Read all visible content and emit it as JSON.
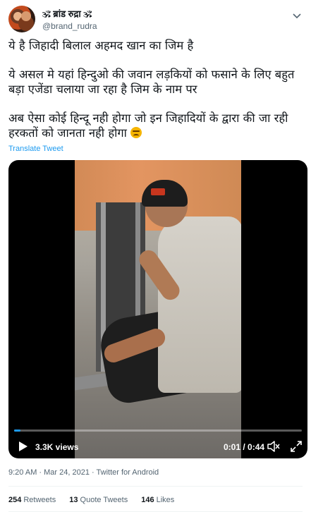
{
  "tweet": {
    "author": {
      "display_name": "🕉 ब्रांड रुद्रा 🕉",
      "handle": "@brand_rudra"
    },
    "text": {
      "line1": "ये है जिहादी बिलाल अहमद खान का जिम है",
      "para2": " ये असल मे यहां हिन्दुओ की जवान लड़कियों को फसाने के लिए बहुत बड़ा एजेंडा चलाया जा रहा है जिम के नाम पर",
      "para3": "अब ऐसा कोई हिन्दू नही होगा जो इन जिहादियों के द्वारा की जा रही  हरकतों को जानता नही होगा "
    },
    "translate_label": "Translate Tweet",
    "video": {
      "views": "3.3K views",
      "time": "0:01 / 0:44",
      "progress": 0.023,
      "accent_color": "#1d9bf0"
    },
    "meta": "9:20 AM · Mar 24, 2021 · Twitter for Android",
    "stats": {
      "retweets_count": "254",
      "retweets_label": "Retweets",
      "quotes_count": "13",
      "quotes_label": "Quote Tweets",
      "likes_count": "146",
      "likes_label": "Likes"
    }
  }
}
